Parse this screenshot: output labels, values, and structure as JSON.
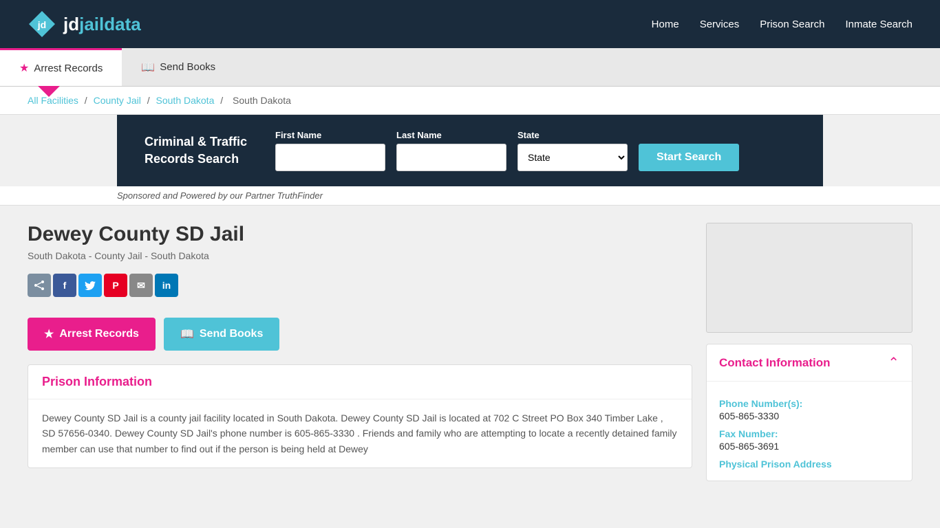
{
  "nav": {
    "logo_jd": "jd",
    "logo_data": "jaildata",
    "links": [
      {
        "label": "Home",
        "href": "#"
      },
      {
        "label": "Services",
        "href": "#"
      },
      {
        "label": "Prison Search",
        "href": "#"
      },
      {
        "label": "Inmate Search",
        "href": "#"
      }
    ]
  },
  "tabs": [
    {
      "label": "Arrest Records",
      "icon": "star",
      "active": true
    },
    {
      "label": "Send Books",
      "icon": "book",
      "active": false
    }
  ],
  "breadcrumb": {
    "items": [
      {
        "label": "All Facilities",
        "href": "#"
      },
      {
        "label": "County Jail",
        "href": "#"
      },
      {
        "label": "South Dakota",
        "href": "#"
      },
      {
        "label": "South Dakota",
        "current": true
      }
    ],
    "separator": "/"
  },
  "search": {
    "title_line1": "Criminal & Traffic",
    "title_line2": "Records Search",
    "first_name_label": "First Name",
    "first_name_placeholder": "",
    "last_name_label": "Last Name",
    "last_name_placeholder": "",
    "state_label": "State",
    "state_default": "State",
    "button_label": "Start Search",
    "sponsored_text": "Sponsored and Powered by our Partner TruthFinder"
  },
  "facility": {
    "title": "Dewey County SD Jail",
    "subtitle": "South Dakota - County Jail - South Dakota"
  },
  "social": [
    {
      "label": "S",
      "name": "share",
      "css": "share"
    },
    {
      "label": "f",
      "name": "facebook",
      "css": "facebook"
    },
    {
      "label": "t",
      "name": "twitter",
      "css": "twitter"
    },
    {
      "label": "P",
      "name": "pinterest",
      "css": "pinterest"
    },
    {
      "label": "✉",
      "name": "email",
      "css": "email"
    },
    {
      "label": "in",
      "name": "linkedin",
      "css": "linkedin"
    }
  ],
  "action_buttons": {
    "arrest_label": "Arrest Records",
    "send_books_label": "Send Books"
  },
  "prison_info": {
    "section_title": "Prison Information",
    "body": "Dewey County SD Jail is a county jail facility located in South Dakota. Dewey County SD Jail is located at 702 C Street PO Box 340 Timber Lake , SD 57656-0340. Dewey County SD Jail's phone number is 605-865-3330 . Friends and family who are attempting to locate a recently detained family member can use that number to find out if the person is being held at Dewey"
  },
  "contact": {
    "section_title": "Contact Information",
    "phone_label": "Phone Number(s):",
    "phone_value": "605-865-3330",
    "fax_label": "Fax Number:",
    "fax_value": "605-865-3691",
    "address_label": "Physical Prison Address"
  }
}
